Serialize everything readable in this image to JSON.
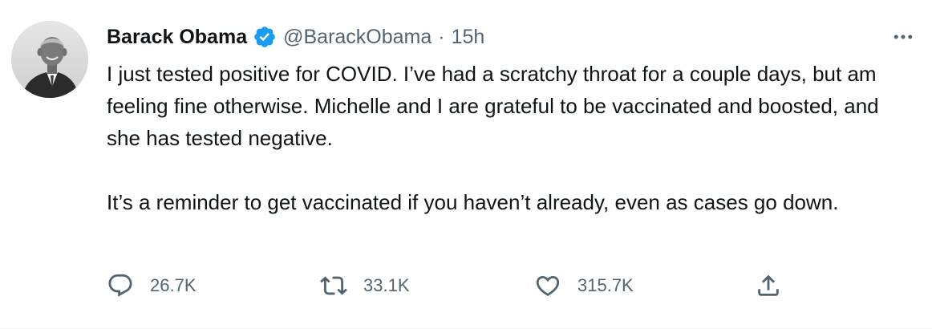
{
  "tweet": {
    "author": {
      "display_name": "Barack Obama",
      "handle": "@BarackObama",
      "verified_icon": "verified-badge-icon",
      "avatar_icon": "avatar-photo"
    },
    "separator": "·",
    "time": "15h",
    "body": {
      "paragraph_1": "I just tested positive for COVID. I’ve had a scratchy throat for a couple days, but am feeling fine otherwise. Michelle and I are grateful to be vaccinated and boosted, and she has tested negative.",
      "paragraph_2": "It’s a reminder to get vaccinated if you haven’t already, even as cases go down."
    },
    "actions": {
      "reply": {
        "icon": "reply-icon",
        "count": "26.7K"
      },
      "retweet": {
        "icon": "retweet-icon",
        "count": "33.1K"
      },
      "like": {
        "icon": "heart-icon",
        "count": "315.7K"
      },
      "share": {
        "icon": "share-icon"
      }
    },
    "more_icon": "more-options-icon"
  },
  "colors": {
    "text_primary": "#0f1419",
    "text_secondary": "#536471",
    "verified_blue": "#1d9bf0",
    "background": "#ffffff"
  }
}
